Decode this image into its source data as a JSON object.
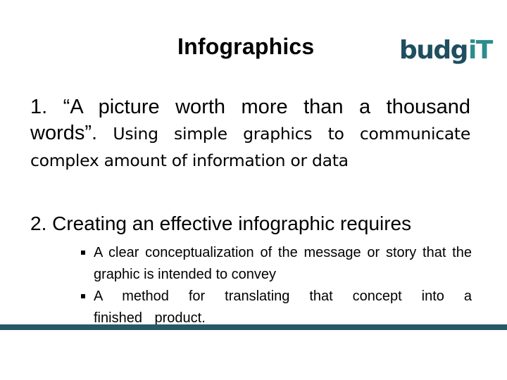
{
  "slide": {
    "title": "Infographics",
    "logo": {
      "text_main": "budg",
      "text_accent": "iT",
      "color_main": "#1f4e5f",
      "color_accent": "#2f8c8c"
    },
    "point1": {
      "lead": "1. “A picture worth more than a thousand words”.",
      "rest": " Using simple graphics to communicate complex amount of information or data"
    },
    "point2": {
      "heading": "2. Creating an effective infographic requires",
      "bullets": [
        "A clear conceptualization of the message or story that the graphic is intended to convey",
        "A method for translating that concept into a finished product."
      ]
    },
    "footer_bar_color": "#265866"
  }
}
